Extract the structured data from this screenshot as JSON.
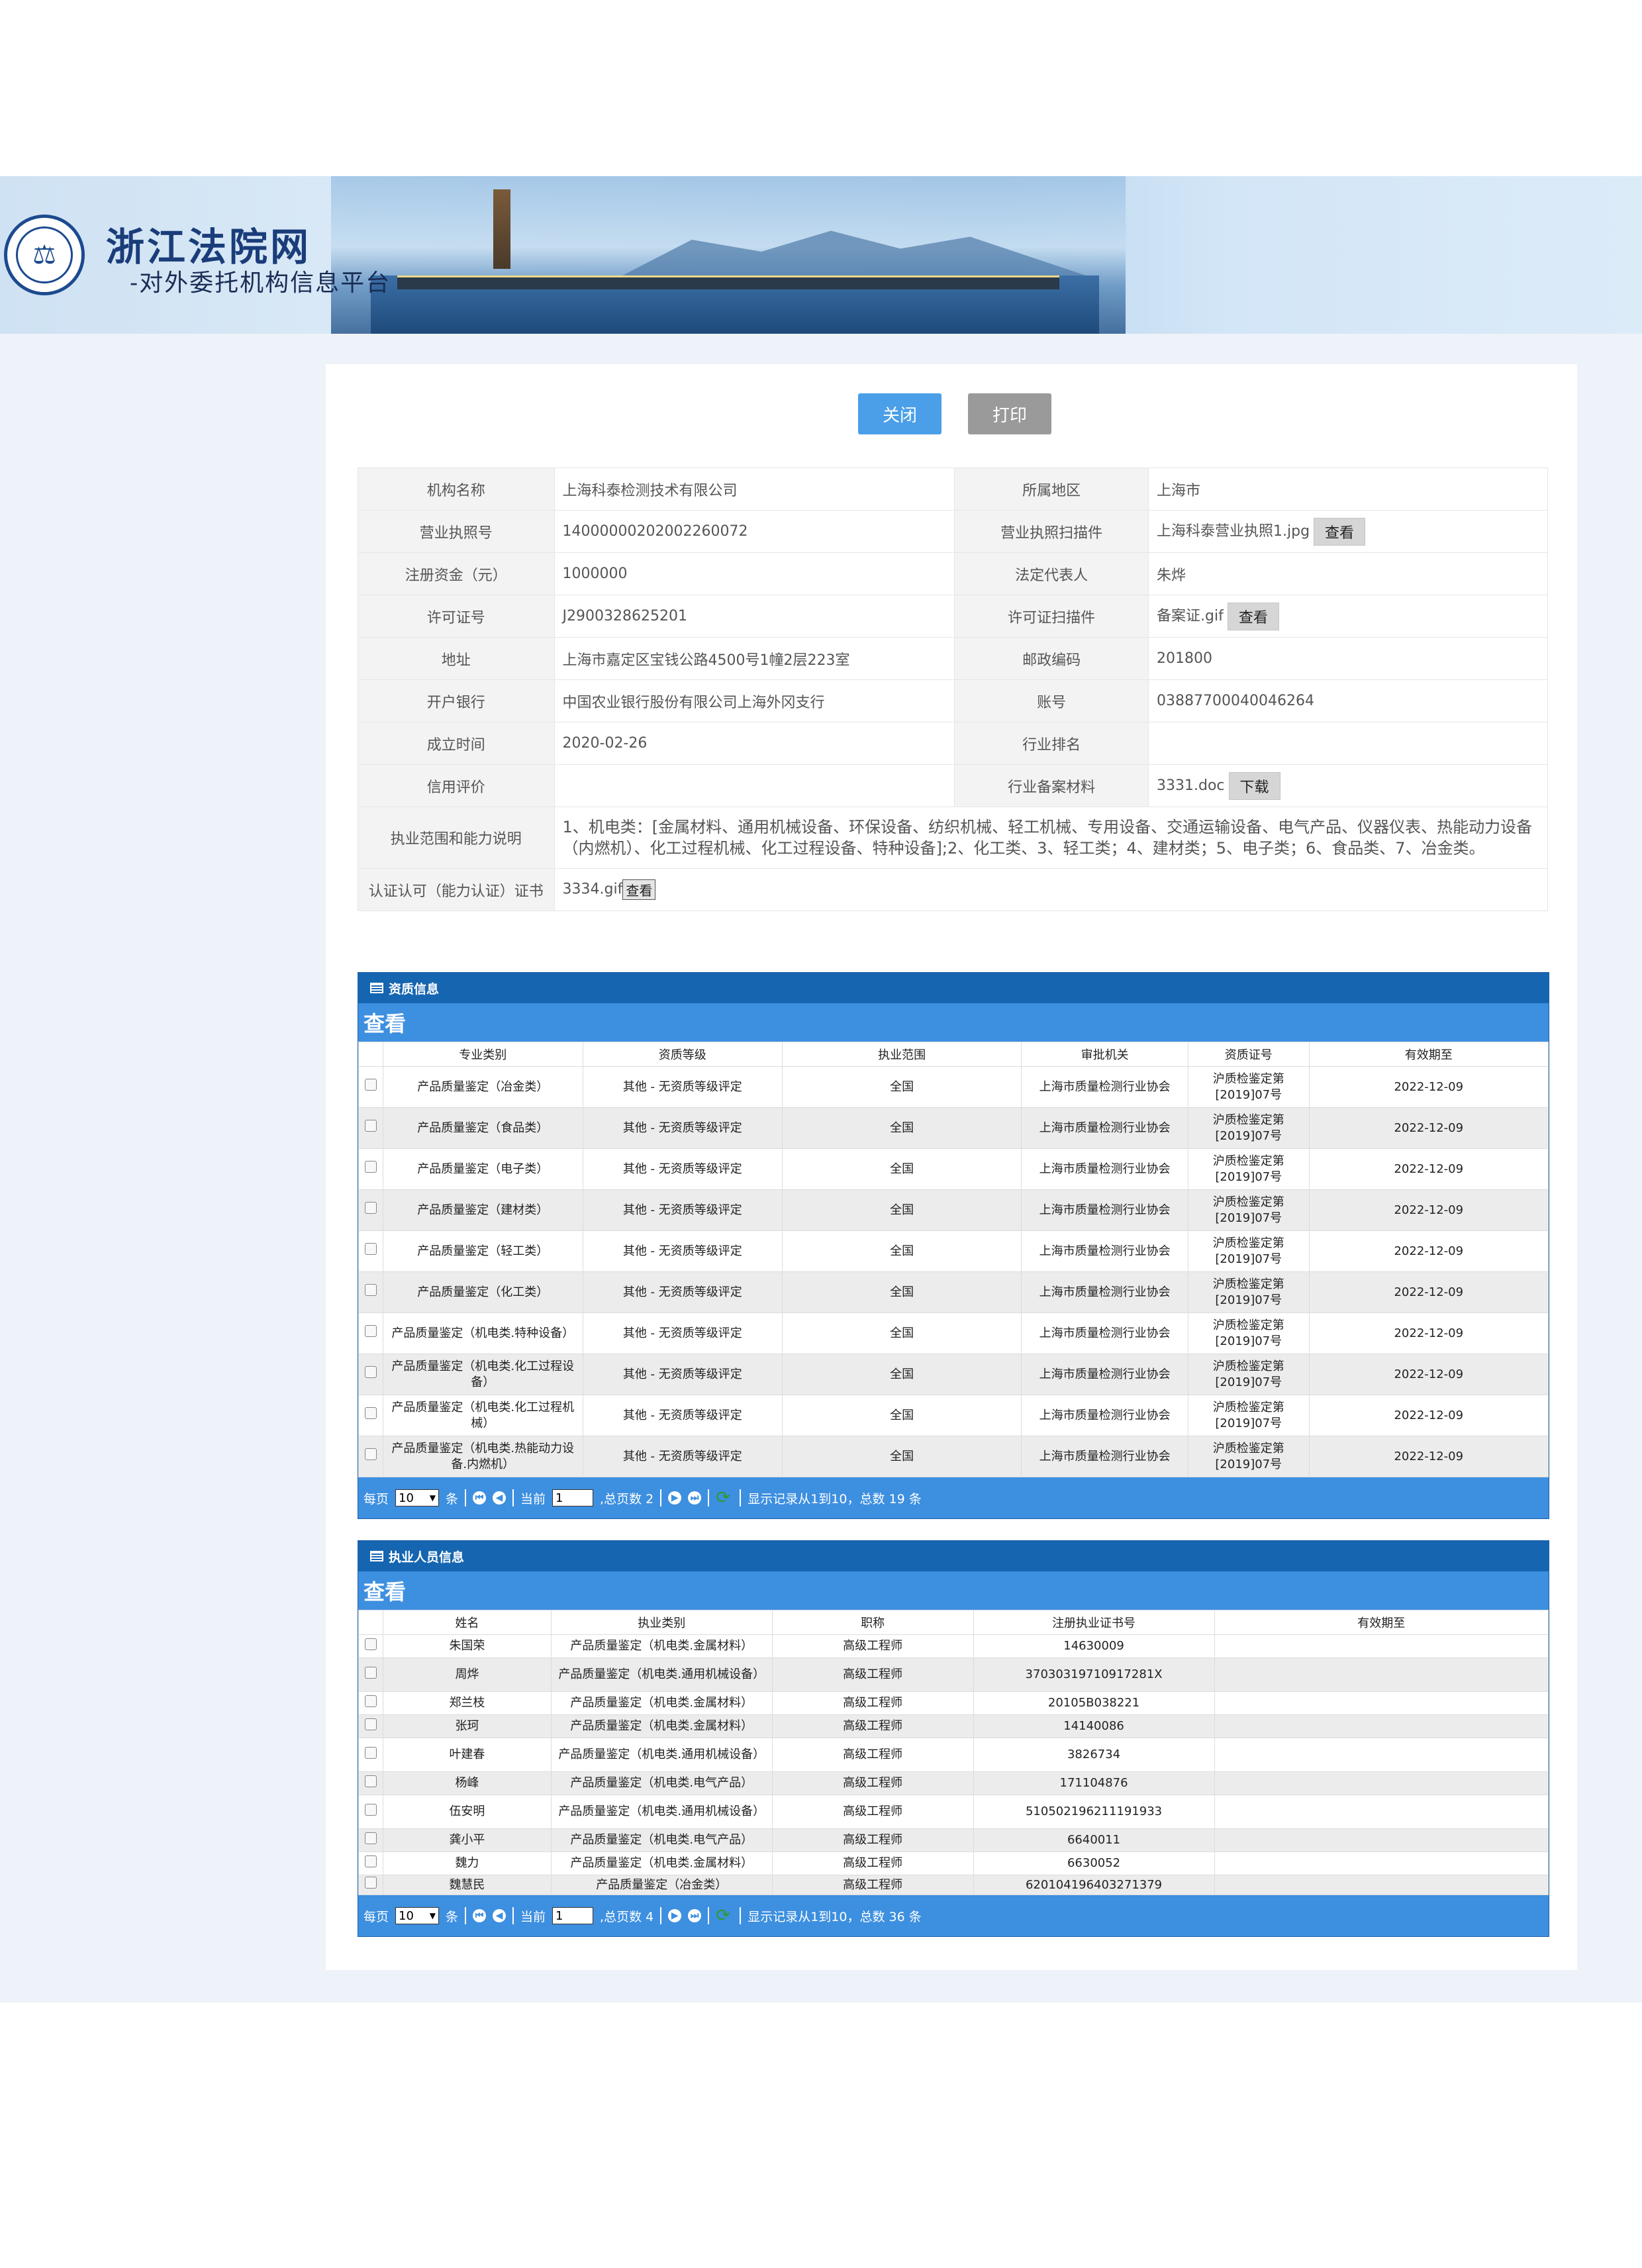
{
  "header": {
    "site_title": "浙江法院网",
    "site_subtitle": "-对外委托机构信息平台"
  },
  "actions": {
    "close": "关闭",
    "print": "打印"
  },
  "info": {
    "rows": [
      [
        "机构名称",
        "上海科泰检测技术有限公司",
        "所属地区",
        "上海市"
      ],
      [
        "营业执照号",
        "140000002020022600 72",
        "营业执照扫描件",
        "上海科泰营业执照1.jpg"
      ],
      [
        "注册资金（元）",
        "1000000",
        "法定代表人",
        "朱烨"
      ],
      [
        "许可证号",
        "J2900328625201",
        "许可证扫描件",
        "备案证.gif"
      ],
      [
        "地址",
        "上海市嘉定区宝钱公路4500号1幢2层223室",
        "邮政编码",
        "201800"
      ],
      [
        "开户银行",
        "中国农业银行股份有限公司上海外冈支行",
        "账号",
        "03887700040046264"
      ],
      [
        "成立时间",
        "2020-02-26",
        "行业排名",
        ""
      ],
      [
        "信用评价",
        "",
        "行业备案材料",
        "3331.doc"
      ]
    ],
    "license_no_fixed": "14000000202002260072",
    "view_label": "查看",
    "download_label": "下载",
    "scope_label": "执业范围和能力说明",
    "scope_text": "1、机电类：[金属材料、通用机械设备、环保设备、纺织机械、轻工机械、专用设备、交通运输设备、电气产品、仪器仪表、热能动力设备（内燃机）、化工过程机械、化工过程设备、特种设备];2、化工类、3、轻工类；4、建材类；5、电子类；6、食品类、7、冶金类。",
    "cert_label": "认证认可（能力认证）证书",
    "cert_file": "3334.gif"
  },
  "qualification": {
    "title": "资质信息",
    "toolbar": "查看",
    "columns": [
      "专业类别",
      "资质等级",
      "执业范围",
      "审批机关",
      "资质证号",
      "有效期至"
    ],
    "rows": [
      [
        "产品质量鉴定（冶金类）",
        "其他 - 无资质等级评定",
        "全国",
        "上海市质量检测行业协会",
        "沪质检鉴定第[2019]07号",
        "2022-12-09"
      ],
      [
        "产品质量鉴定（食品类）",
        "其他 - 无资质等级评定",
        "全国",
        "上海市质量检测行业协会",
        "沪质检鉴定第[2019]07号",
        "2022-12-09"
      ],
      [
        "产品质量鉴定（电子类）",
        "其他 - 无资质等级评定",
        "全国",
        "上海市质量检测行业协会",
        "沪质检鉴定第[2019]07号",
        "2022-12-09"
      ],
      [
        "产品质量鉴定（建材类）",
        "其他 - 无资质等级评定",
        "全国",
        "上海市质量检测行业协会",
        "沪质检鉴定第[2019]07号",
        "2022-12-09"
      ],
      [
        "产品质量鉴定（轻工类）",
        "其他 - 无资质等级评定",
        "全国",
        "上海市质量检测行业协会",
        "沪质检鉴定第[2019]07号",
        "2022-12-09"
      ],
      [
        "产品质量鉴定（化工类）",
        "其他 - 无资质等级评定",
        "全国",
        "上海市质量检测行业协会",
        "沪质检鉴定第[2019]07号",
        "2022-12-09"
      ],
      [
        "产品质量鉴定（机电类.特种设备）",
        "其他 - 无资质等级评定",
        "全国",
        "上海市质量检测行业协会",
        "沪质检鉴定第[2019]07号",
        "2022-12-09"
      ],
      [
        "产品质量鉴定（机电类.化工过程设备）",
        "其他 - 无资质等级评定",
        "全国",
        "上海市质量检测行业协会",
        "沪质检鉴定第[2019]07号",
        "2022-12-09"
      ],
      [
        "产品质量鉴定（机电类.化工过程机械）",
        "其他 - 无资质等级评定",
        "全国",
        "上海市质量检测行业协会",
        "沪质检鉴定第[2019]07号",
        "2022-12-09"
      ],
      [
        "产品质量鉴定（机电类.热能动力设备.内燃机）",
        "其他 - 无资质等级评定",
        "全国",
        "上海市质量检测行业协会",
        "沪质检鉴定第[2019]07号",
        "2022-12-09"
      ]
    ],
    "pager": {
      "per_page_label": "每页",
      "per_page": "10",
      "per_page_unit": "条",
      "current_label": "当前",
      "current": "1",
      "total_pages": ",总页数 2",
      "summary": "显示记录从1到10，总数 19 条"
    }
  },
  "personnel": {
    "title": "执业人员信息",
    "toolbar": "查看",
    "columns": [
      "姓名",
      "执业类别",
      "职称",
      "注册执业证书号",
      "有效期至"
    ],
    "rows": [
      [
        "朱国荣",
        "产品质量鉴定（机电类.金属材料）",
        "高级工程师",
        "14630009",
        ""
      ],
      [
        "周烨",
        "产品质量鉴定（机电类.通用机械设备）",
        "高级工程师",
        "37030319710917281X",
        ""
      ],
      [
        "郑兰枝",
        "产品质量鉴定（机电类.金属材料）",
        "高级工程师",
        "20105B038221",
        ""
      ],
      [
        "张珂",
        "产品质量鉴定（机电类.金属材料）",
        "高级工程师",
        "14140086",
        ""
      ],
      [
        "叶建春",
        "产品质量鉴定（机电类.通用机械设备）",
        "高级工程师",
        "3826734",
        ""
      ],
      [
        "杨峰",
        "产品质量鉴定（机电类.电气产品）",
        "高级工程师",
        "171104876",
        ""
      ],
      [
        "伍安明",
        "产品质量鉴定（机电类.通用机械设备）",
        "高级工程师",
        "510502196211191933",
        ""
      ],
      [
        "龚小平",
        "产品质量鉴定（机电类.电气产品）",
        "高级工程师",
        "6640011",
        ""
      ],
      [
        "魏力",
        "产品质量鉴定（机电类.金属材料）",
        "高级工程师",
        "6630052",
        ""
      ],
      [
        "魏慧民",
        "产品质量鉴定（冶金类）",
        "高级工程师",
        "620104196403271379",
        ""
      ]
    ],
    "pager": {
      "per_page_label": "每页",
      "per_page": "10",
      "per_page_unit": "条",
      "current_label": "当前",
      "current": "1",
      "total_pages": ",总页数 4",
      "summary": "显示记录从1到10，总数 36 条"
    }
  }
}
